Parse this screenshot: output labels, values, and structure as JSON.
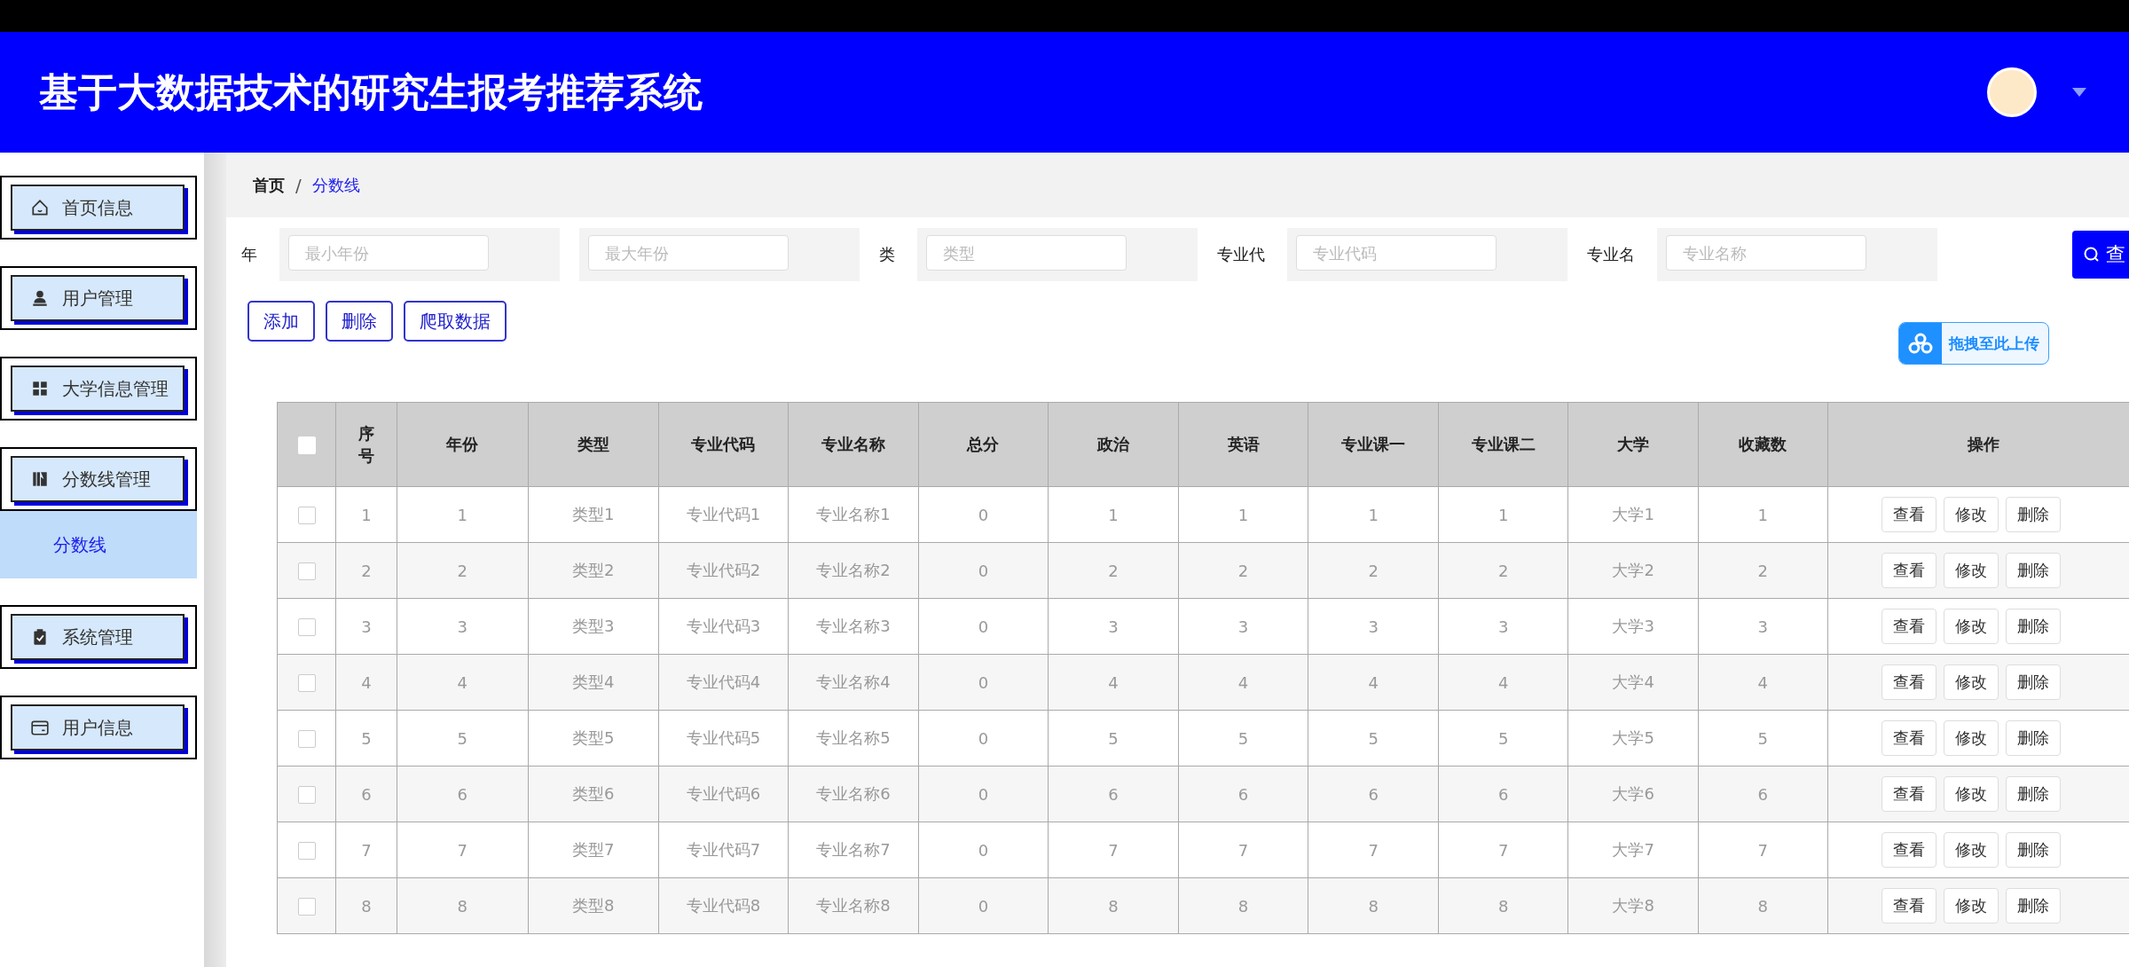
{
  "header": {
    "title": "基于大数据技术的研究生报考推荐系统"
  },
  "sidebar": {
    "items": [
      {
        "label": "首页信息",
        "kind": "home"
      },
      {
        "label": "用户管理",
        "kind": "person"
      },
      {
        "label": "大学信息管理",
        "kind": "grid"
      },
      {
        "label": "分数线管理",
        "kind": "book",
        "children": [
          {
            "label": "分数线",
            "selected": true
          }
        ]
      },
      {
        "label": "系统管理",
        "kind": "clipboard"
      },
      {
        "label": "用户信息",
        "kind": "card"
      }
    ]
  },
  "breadcrumb": {
    "separator": "/",
    "items": [
      {
        "label": "首页",
        "selected": false
      },
      {
        "label": "分数线",
        "selected": true
      }
    ]
  },
  "filters": [
    {
      "label": "年",
      "placeholder": "最小年份"
    },
    {
      "placeholder": "最大年份"
    },
    {
      "label": "类",
      "placeholder": "类型"
    },
    {
      "label": "专业代",
      "placeholder": "专业代码"
    },
    {
      "label": "专业名",
      "placeholder": "专业名称"
    }
  ],
  "search_button": "查",
  "actions": [
    "添加",
    "删除",
    "爬取数据"
  ],
  "upload": {
    "label": "拖拽至此上传"
  },
  "table": {
    "header_checked": false,
    "columns": [
      "序号",
      "年份",
      "类型",
      "专业代码",
      "专业名称",
      "总分",
      "政治",
      "英语",
      "专业课一",
      "专业课二",
      "大学",
      "收藏数",
      "操作"
    ],
    "rows": [
      {
        "selected": false,
        "cells": [
          "1",
          "1",
          "类型1",
          "专业代码1",
          "专业名称1",
          "0",
          "1",
          "1",
          "1",
          "1",
          "大学1",
          "1"
        ],
        "actions": [
          "查看",
          "修改",
          "删除"
        ]
      },
      {
        "selected": false,
        "cells": [
          "2",
          "2",
          "类型2",
          "专业代码2",
          "专业名称2",
          "0",
          "2",
          "2",
          "2",
          "2",
          "大学2",
          "2"
        ],
        "actions": [
          "查看",
          "修改",
          "删除"
        ]
      },
      {
        "selected": false,
        "cells": [
          "3",
          "3",
          "类型3",
          "专业代码3",
          "专业名称3",
          "0",
          "3",
          "3",
          "3",
          "3",
          "大学3",
          "3"
        ],
        "actions": [
          "查看",
          "修改",
          "删除"
        ]
      },
      {
        "selected": false,
        "cells": [
          "4",
          "4",
          "类型4",
          "专业代码4",
          "专业名称4",
          "0",
          "4",
          "4",
          "4",
          "4",
          "大学4",
          "4"
        ],
        "actions": [
          "查看",
          "修改",
          "删除"
        ]
      },
      {
        "selected": false,
        "cells": [
          "5",
          "5",
          "类型5",
          "专业代码5",
          "专业名称5",
          "0",
          "5",
          "5",
          "5",
          "5",
          "大学5",
          "5"
        ],
        "actions": [
          "查看",
          "修改",
          "删除"
        ]
      },
      {
        "selected": false,
        "cells": [
          "6",
          "6",
          "类型6",
          "专业代码6",
          "专业名称6",
          "0",
          "6",
          "6",
          "6",
          "6",
          "大学6",
          "6"
        ],
        "actions": [
          "查看",
          "修改",
          "删除"
        ]
      },
      {
        "selected": false,
        "cells": [
          "7",
          "7",
          "类型7",
          "专业代码7",
          "专业名称7",
          "0",
          "7",
          "7",
          "7",
          "7",
          "大学7",
          "7"
        ],
        "actions": [
          "查看",
          "修改",
          "删除"
        ]
      },
      {
        "selected": false,
        "cells": [
          "8",
          "8",
          "类型8",
          "专业代码8",
          "专业名称8",
          "0",
          "8",
          "8",
          "8",
          "8",
          "大学8",
          "8"
        ],
        "actions": [
          "查看",
          "修改",
          "删除"
        ]
      }
    ]
  }
}
